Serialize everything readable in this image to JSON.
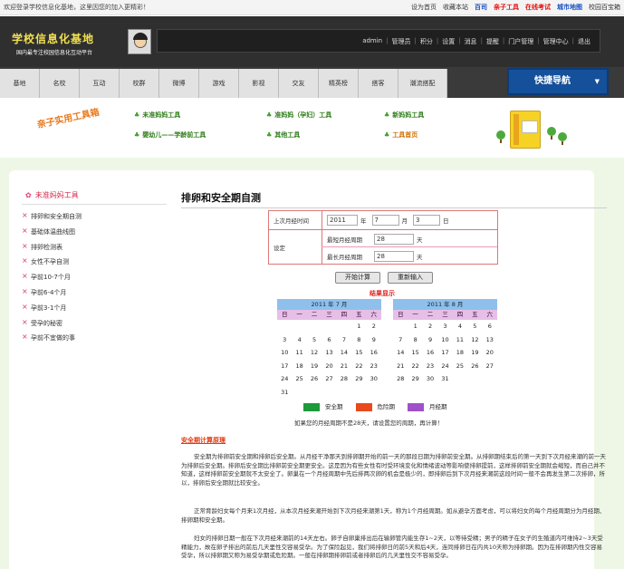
{
  "topbar": {
    "welcome": "欢迎登录学校信息化基地，这里因您的加入更精彩！",
    "links": [
      {
        "label": "设为首页",
        "color": "#333"
      },
      {
        "label": "收藏本站",
        "color": "#333"
      },
      {
        "label": "百司",
        "color": "#1a4fc4"
      },
      {
        "label": "亲子工具",
        "color": "#e01010"
      },
      {
        "label": "在线考试",
        "color": "#e01010"
      },
      {
        "label": "城市地图",
        "color": "#1a4fc4"
      },
      {
        "label": "校园百宝箱",
        "color": "#333"
      }
    ]
  },
  "header": {
    "logo_title": "学校信息化基地",
    "logo_sub": "国内最专注校园信息化互动平台",
    "user_links": [
      "admin",
      "管理员",
      "积分",
      "设置",
      "消息",
      "提醒",
      "门户管理",
      "管理中心",
      "退出"
    ]
  },
  "nav": {
    "items": [
      "基地",
      "名校",
      "互动",
      "校群",
      "微博",
      "游戏",
      "影视",
      "交友",
      "精英榜",
      "搭客",
      "潮流搭配"
    ],
    "quick": "快捷导航"
  },
  "toolbox": {
    "title": "亲子实用工具箱",
    "links": [
      {
        "label": "未准妈妈工具",
        "color": "green"
      },
      {
        "label": "准妈妈（孕妇）工具",
        "color": "green"
      },
      {
        "label": "新妈妈工具",
        "color": "green"
      },
      {
        "label": "婴幼儿——学龄前工具",
        "color": "green"
      },
      {
        "label": "其他工具",
        "color": "green"
      },
      {
        "label": "工具首页",
        "color": "orange"
      }
    ]
  },
  "sidebar": {
    "heading": "未准妈妈工具",
    "items": [
      "排卵和安全期自测",
      "基础体温曲线图",
      "排卵检测表",
      "女性不孕自测",
      "孕前10-7个月",
      "孕前6-4个月",
      "孕前3-1个月",
      "受孕的秘密",
      "孕前不宜做的事"
    ]
  },
  "main": {
    "title": "排卵和安全期自测",
    "form": {
      "last_label": "上次月经时间",
      "year": "2011",
      "year_unit": "年",
      "month": "7",
      "month_unit": "月",
      "day": "3",
      "day_unit": "日",
      "set_label": "设定",
      "shortest_label": "最短月经周期",
      "shortest": "28",
      "longest_label": "最长月经周期",
      "longest": "28",
      "days_unit": "天",
      "calc_btn": "开始计算",
      "reset_btn": "重新输入"
    },
    "result_title": "结果显示",
    "calendars": [
      {
        "title": "2011 年 7 月",
        "weekdays": [
          "日",
          "一",
          "二",
          "三",
          "四",
          "五",
          "六"
        ],
        "offset": 5,
        "days": 31
      },
      {
        "title": "2011 年 8 月",
        "weekdays": [
          "日",
          "一",
          "二",
          "三",
          "四",
          "五",
          "六"
        ],
        "offset": 1,
        "days": 31
      }
    ],
    "legend": [
      {
        "label": "安全期",
        "color": "#1e9a3c"
      },
      {
        "label": "危险期",
        "color": "#e84a1e"
      },
      {
        "label": "月经期",
        "color": "#a050c8"
      }
    ],
    "note": "如果您的月经周期不是28天，请设置您的周期，再计算！",
    "section_title": "安全期计算原理",
    "paragraphs": [
      "安全期为排卵前安全期和排卵后安全期。从月经干净那天到排卵期开始的前一天的那段日期为排卵前安全期。从排卵期结束后的第一天到下次月经来潮的前一天为排卵后安全期。排卵后安全期比排卵前安全期更安全。这是因为有些女性有时受环境变化和情绪波动等影响使排卵提前，这样排卵前安全期就会缩短，而自己并不知道，这样排卵前安全期就不太安全了。卵巢在一个月经周期中先后排两次卵的机会是极少的，即排卵后到下次月经来潮前这段时间一般不会再发生第二次排卵，所以，排卵后安全期就比较安全。",
      "正常育龄妇女每个月来1次月经，从本次月经来潮开始到下次月经来潮第1天，称为1个月经周期。如从避孕方面考虑，可以将妇女的每个月经周期分为月经期、排卵期和安全期。",
      "妇女的排卵日期一般在下次月经来潮前的14天左右。卵子自卵巢排出后在输卵管内能生存1~2天，以等待受精；男子的精子在女子的生殖道内可维持2~3天受精能力，故在卵子排出的前后几天里性交容易受孕。为了保险起见，我们将排卵日的前5天和后4天，连同排卵日在内共10天称为排卵期。因为在排卵期内性交容易受孕，所以排卵期又称为易受孕期或危险期。一般在排卵期排卵前或者排卵后的几天里性交不容易受孕。"
    ]
  }
}
